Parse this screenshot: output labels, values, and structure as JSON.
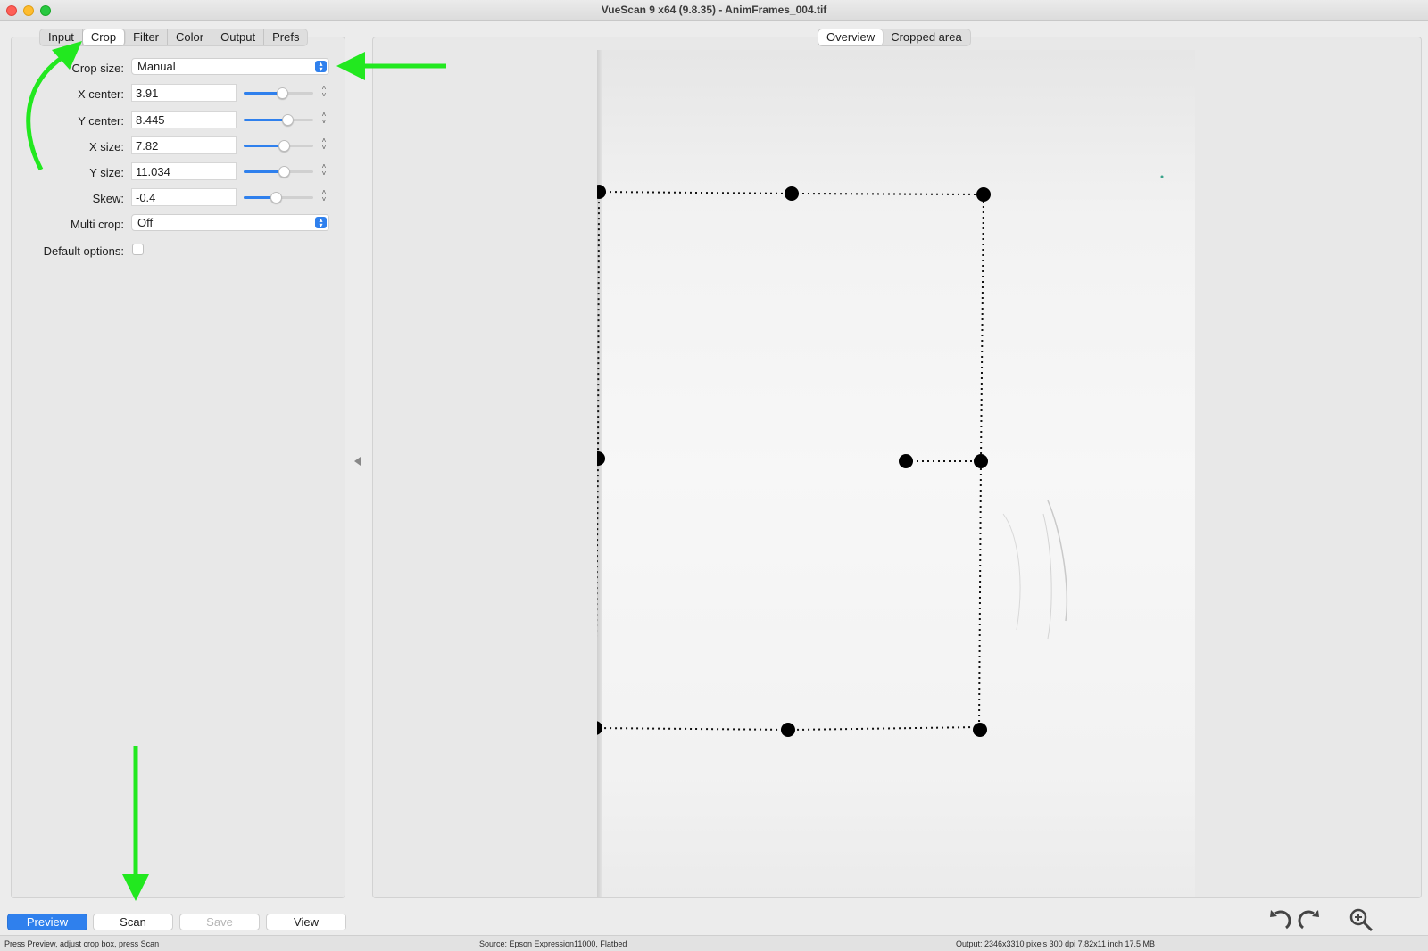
{
  "window": {
    "title": "VueScan 9 x64 (9.8.35) - AnimFrames_004.tif"
  },
  "tabs": [
    {
      "label": "Input"
    },
    {
      "label": "Crop"
    },
    {
      "label": "Filter"
    },
    {
      "label": "Color"
    },
    {
      "label": "Output"
    },
    {
      "label": "Prefs"
    }
  ],
  "active_tab": "Crop",
  "crop": {
    "crop_size": {
      "label": "Crop size:",
      "value": "Manual"
    },
    "x_center": {
      "label": "X center:",
      "value": "3.91",
      "slider_fraction": 0.55
    },
    "y_center": {
      "label": "Y center:",
      "value": "8.445",
      "slider_fraction": 0.63
    },
    "x_size": {
      "label": "X size:",
      "value": "7.82",
      "slider_fraction": 0.58
    },
    "y_size": {
      "label": "Y size:",
      "value": "11.034",
      "slider_fraction": 0.58
    },
    "skew": {
      "label": "Skew:",
      "value": "-0.4",
      "slider_fraction": 0.46
    },
    "multi_crop": {
      "label": "Multi crop:",
      "value": "Off"
    },
    "default_options": {
      "label": "Default options:",
      "checked": false
    }
  },
  "view_tabs": [
    {
      "label": "Overview"
    },
    {
      "label": "Cropped area"
    }
  ],
  "active_view_tab": "Overview",
  "buttons": {
    "preview": "Preview",
    "scan": "Scan",
    "save": "Save",
    "view": "View"
  },
  "toolbar_icons": [
    "rotate-left-icon",
    "rotate-right-icon",
    "zoom-in-icon"
  ],
  "status": {
    "left": "Press Preview, adjust crop box, press Scan",
    "center": "Source: Epson Expression11000, Flatbed",
    "right": "Output: 2346x3310 pixels 300 dpi 7.82x11 inch 17.5 MB"
  },
  "colors": {
    "accent": "#2f80ed",
    "annotation_arrow": "#22e81f",
    "crop_handle": "#000000"
  }
}
